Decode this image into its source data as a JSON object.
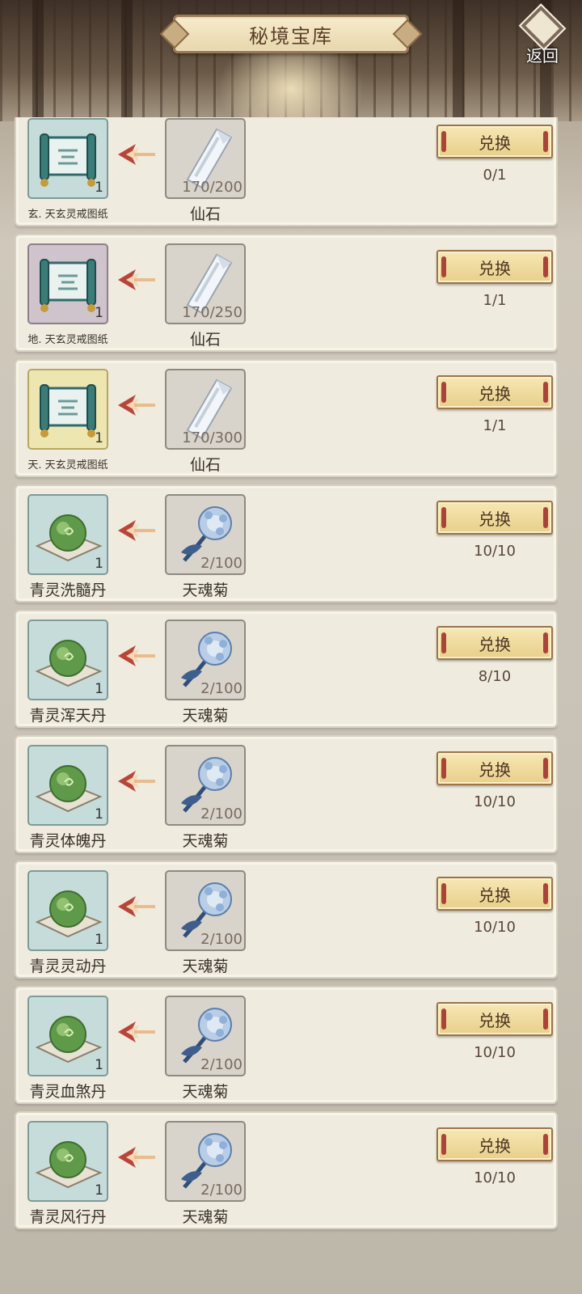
{
  "header": {
    "title": "秘境宝库",
    "back_label": "返回"
  },
  "button_label": "兑换",
  "rows": [
    {
      "reward_name": "玄. 天玄灵戒图纸",
      "reward_qty": "1",
      "reward_bg": "blue",
      "reward_icon": "scroll-icon",
      "cost_name": "仙石",
      "cost_qty": "170/200",
      "cost_icon": "crystal-icon",
      "limit": "0/1"
    },
    {
      "reward_name": "地. 天玄灵戒图纸",
      "reward_qty": "1",
      "reward_bg": "purple",
      "reward_icon": "scroll-icon",
      "cost_name": "仙石",
      "cost_qty": "170/250",
      "cost_icon": "crystal-icon",
      "limit": "1/1"
    },
    {
      "reward_name": "天. 天玄灵戒图纸",
      "reward_qty": "1",
      "reward_bg": "gold",
      "reward_icon": "scroll-icon",
      "cost_name": "仙石",
      "cost_qty": "170/300",
      "cost_icon": "crystal-icon",
      "limit": "1/1"
    },
    {
      "reward_name": "青灵洗髓丹",
      "reward_qty": "1",
      "reward_bg": "blue",
      "reward_icon": "green-pill-icon",
      "cost_name": "天魂菊",
      "cost_qty": "2/100",
      "cost_icon": "blue-flower-icon",
      "limit": "10/10"
    },
    {
      "reward_name": "青灵浑天丹",
      "reward_qty": "1",
      "reward_bg": "blue",
      "reward_icon": "green-pill-icon",
      "cost_name": "天魂菊",
      "cost_qty": "2/100",
      "cost_icon": "blue-flower-icon",
      "limit": "8/10"
    },
    {
      "reward_name": "青灵体魄丹",
      "reward_qty": "1",
      "reward_bg": "blue",
      "reward_icon": "green-pill-icon",
      "cost_name": "天魂菊",
      "cost_qty": "2/100",
      "cost_icon": "blue-flower-icon",
      "limit": "10/10"
    },
    {
      "reward_name": "青灵灵动丹",
      "reward_qty": "1",
      "reward_bg": "blue",
      "reward_icon": "green-pill-icon",
      "cost_name": "天魂菊",
      "cost_qty": "2/100",
      "cost_icon": "blue-flower-icon",
      "limit": "10/10"
    },
    {
      "reward_name": "青灵血煞丹",
      "reward_qty": "1",
      "reward_bg": "blue",
      "reward_icon": "green-pill-icon",
      "cost_name": "天魂菊",
      "cost_qty": "2/100",
      "cost_icon": "blue-flower-icon",
      "limit": "10/10"
    },
    {
      "reward_name": "青灵风行丹",
      "reward_qty": "1",
      "reward_bg": "blue",
      "reward_icon": "green-pill-icon",
      "cost_name": "天魂菊",
      "cost_qty": "2/100",
      "cost_icon": "blue-flower-icon",
      "limit": "10/10"
    }
  ],
  "colors": {
    "button_fill": "#e8cf8a",
    "button_border": "#9c7447",
    "accent_red": "#a8443a",
    "arrow": "#b9453a"
  }
}
